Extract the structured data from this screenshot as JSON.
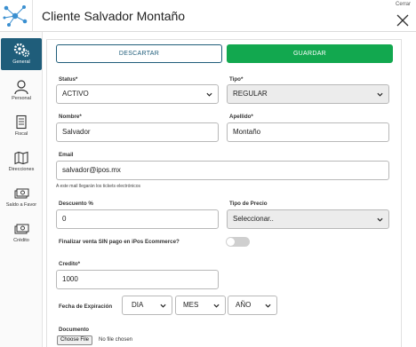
{
  "header": {
    "title": "Cliente Salvador Montaño",
    "close_label": "Cerrar"
  },
  "sidebar": {
    "items": [
      {
        "label": "General",
        "icon": "gears-icon",
        "active": true
      },
      {
        "label": "Personal",
        "icon": "person-icon",
        "active": false
      },
      {
        "label": "Fiscal",
        "icon": "document-icon",
        "active": false
      },
      {
        "label": "Direcciones",
        "icon": "map-icon",
        "active": false
      },
      {
        "label": "Saldo a Favor",
        "icon": "money-icon",
        "active": false
      },
      {
        "label": "Crédito",
        "icon": "money-icon",
        "active": false
      }
    ]
  },
  "actions": {
    "discard_label": "DESCARTAR",
    "save_label": "GUARDAR"
  },
  "form": {
    "status": {
      "label": "Status*",
      "value": "ACTIVO"
    },
    "tipo": {
      "label": "Tipo*",
      "value": "REGULAR"
    },
    "nombre": {
      "label": "Nombre*",
      "value": "Salvador"
    },
    "apellido": {
      "label": "Apellido*",
      "value": "Montaño"
    },
    "email": {
      "label": "Email",
      "value": "salvador@ipos.mx",
      "hint": "A este mail llegarán los tickets electrónicos"
    },
    "descuento": {
      "label": "Descuento %",
      "value": "0"
    },
    "tipo_precio": {
      "label": "Tipo de Precio",
      "value": "Seleccionar.."
    },
    "venta_sin_pago": {
      "label": "Finalizar venta SIN pago en iPos Ecommerce?",
      "enabled": false
    },
    "credito": {
      "label": "Credito*",
      "value": "1000"
    },
    "fecha_expiracion": {
      "label": "Fecha de Expiración",
      "dia": "DIA",
      "mes": "MES",
      "anio": "AÑO"
    },
    "documento": {
      "label": "Documento",
      "button": "Choose File",
      "file_text": "No file chosen"
    }
  },
  "colors": {
    "accent": "#1f5d7a",
    "save": "#12a84f",
    "logo": "#3a8fd0"
  }
}
